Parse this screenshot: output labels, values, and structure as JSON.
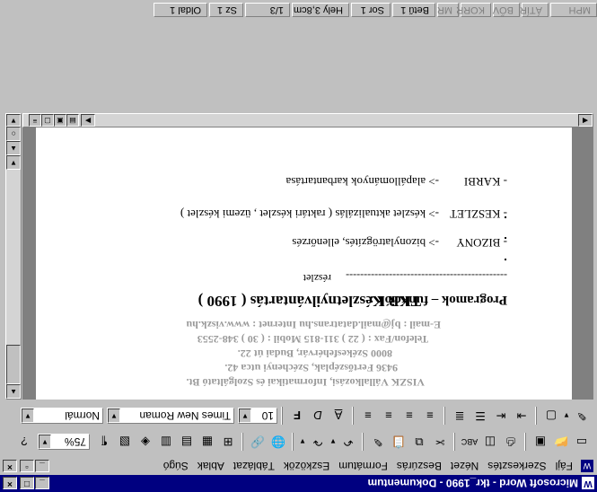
{
  "window": {
    "title": "Microsoft Word - tkr_1990 - Dokumentum"
  },
  "menu": [
    "Fájl",
    "Szerkesztés",
    "Nézet",
    "Beszúrás",
    "Formátum",
    "Eszközök",
    "Táblázat",
    "Ablak",
    "Súgó"
  ],
  "format_toolbar": {
    "style": "Normál",
    "font": "Times New Roman",
    "size": "10",
    "bold": "F",
    "italic": "D",
    "underline": "A"
  },
  "standard_toolbar": {
    "zoom": "75%"
  },
  "document": {
    "address": [
      "VISZK Vállalkozási, Informatikai és Szolgáltató Bt.",
      "9436 Fertőszéplak, Széchenyi utca 42.",
      "8000 Székesfehérvár, Budai út 22.",
      "Telefon/Fax : ( 22 ) 311-815    Mobil : ( 30 ) 348-2553",
      "E-mail : bj@mail.datatrans.hu    Internet : www.viszk.hu"
    ],
    "title": "TKR Készletnyilvántartás ( 1990 )",
    "subtitle": "részlet",
    "bullets": [
      ".",
      ".",
      "."
    ],
    "heading": "Programok – funkciók :",
    "divider": "---------------------------------------------",
    "items": [
      {
        "name": "- BIZONY",
        "desc": "->  bizonylatrögzítés, ellenőrzés"
      },
      {
        "name": "- KESZLET",
        "desc": "->  készlet aktualizálás ( raktári készlet , üzemi készlet )"
      },
      {
        "name": "- KARBI",
        "desc": "->  alapállományok karbantartása"
      }
    ]
  },
  "status": {
    "page": "Oldal 1",
    "section": "Sz 1",
    "pages": "1/3",
    "position": "Hely 3,8cm",
    "line": "Sor 1",
    "column": "Betű 1",
    "modes": [
      "MR",
      "KORR",
      "BŐV",
      "ÁTÍR",
      "MPH"
    ]
  }
}
